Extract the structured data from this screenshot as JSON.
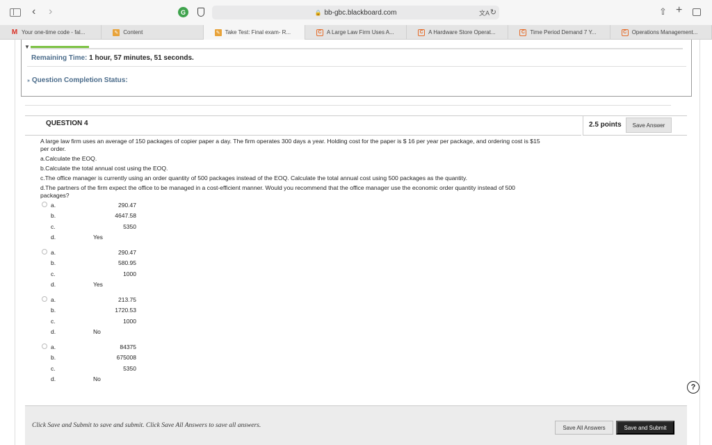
{
  "browser": {
    "url": "bb-gbc.blackboard.com",
    "icons": {
      "sidebar": "sidebar-icon",
      "back": "‹",
      "forward": "›",
      "extension_g": "G",
      "lock": "🔒",
      "translate": "文A",
      "reload": "↻",
      "share": "⇧",
      "new_tab": "+"
    }
  },
  "tabs": [
    {
      "label": "Your one-time code - fal...",
      "icon": "M",
      "type": "gmail"
    },
    {
      "label": "Content",
      "icon": "✎",
      "type": "pencil"
    },
    {
      "label": "Take Test: Final exam- R...",
      "icon": "✎",
      "type": "pencil"
    },
    {
      "label": "A Large Law Firm Uses A...",
      "icon": "C",
      "type": "chegg"
    },
    {
      "label": "A Hardware Store Operat...",
      "icon": "C",
      "type": "chegg"
    },
    {
      "label": "Time Period Demand 7 Y...",
      "icon": "C",
      "type": "chegg"
    },
    {
      "label": "Operations Management...",
      "icon": "C",
      "type": "chegg"
    }
  ],
  "timer": {
    "label": "Remaining Time:",
    "value": "1 hour, 57 minutes, 51 seconds.",
    "progress_fraction": 0.09
  },
  "completion": {
    "label": "Question Completion Status:",
    "chevron": "»"
  },
  "question": {
    "title": "QUESTION 4",
    "points": "2.5 points",
    "save_label": "Save Answer",
    "text": [
      "A large law firm uses an average of 150 packages of copier paper a day. The firm operates 300 days a year. Holding cost for the paper is $ 16 per year per package, and ordering cost is $15 per order.",
      "a.Calculate the EOQ.",
      "b.Calculate the total annual cost using the EOQ.",
      "c.The office manager is currently using an order quantity of 500 packages instead of the EOQ. Calculate the total annual cost using 500 packages as the quantity.",
      "d.The partners of the firm expect the office to be managed in a cost-efficient manner. Would you recommend that the office manager use the economic order quantity instead of 500 packages?"
    ],
    "options": [
      {
        "rows": [
          {
            "letter": "a.",
            "value": "290.47"
          },
          {
            "letter": "b.",
            "value": "4647.58"
          },
          {
            "letter": "c.",
            "value": "5350"
          },
          {
            "letter": "d.",
            "value": "Yes"
          }
        ]
      },
      {
        "rows": [
          {
            "letter": "a.",
            "value": "290.47"
          },
          {
            "letter": "b.",
            "value": "580.95"
          },
          {
            "letter": "c.",
            "value": "1000"
          },
          {
            "letter": "d.",
            "value": "Yes"
          }
        ]
      },
      {
        "rows": [
          {
            "letter": "a.",
            "value": "213.75"
          },
          {
            "letter": "b.",
            "value": "1720.53"
          },
          {
            "letter": "c.",
            "value": "1000"
          },
          {
            "letter": "d.",
            "value": "No"
          }
        ]
      },
      {
        "rows": [
          {
            "letter": "a.",
            "value": "84375"
          },
          {
            "letter": "b.",
            "value": "675008"
          },
          {
            "letter": "c.",
            "value": "5350"
          },
          {
            "letter": "d.",
            "value": "No"
          }
        ]
      }
    ]
  },
  "footer": {
    "message": "Click Save and Submit to save and submit. Click Save All Answers to save all answers.",
    "save_all_label": "Save All Answers",
    "save_submit_label": "Save and Submit",
    "help": "?"
  }
}
